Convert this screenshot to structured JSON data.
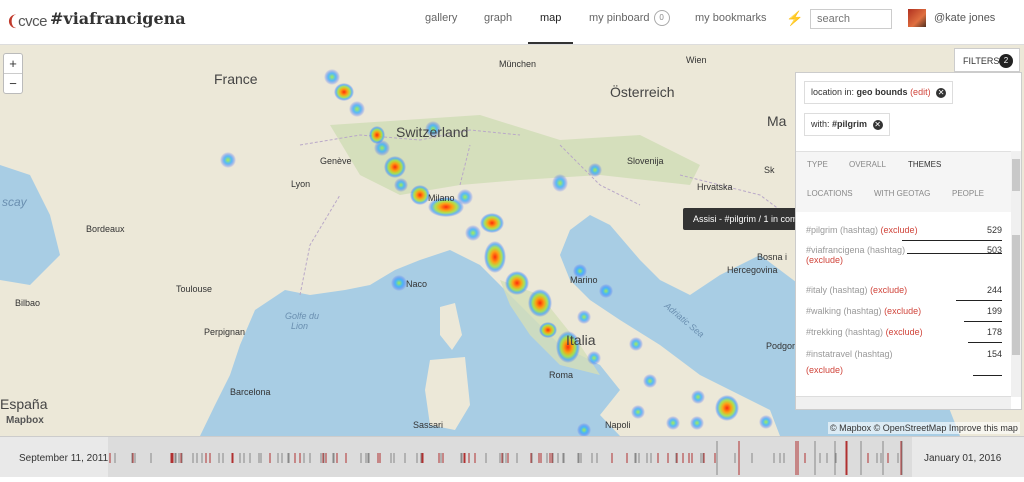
{
  "app": {
    "logo": "cvce",
    "title": "#viafrancigena"
  },
  "nav": {
    "items": [
      {
        "label": "gallery",
        "active": false
      },
      {
        "label": "graph",
        "active": false
      },
      {
        "label": "map",
        "active": true
      },
      {
        "label": "my pinboard",
        "active": false
      },
      {
        "label": "my bookmarks",
        "active": false
      }
    ],
    "pinboard_count": "0",
    "search_placeholder": "search",
    "user": "@kate jones"
  },
  "map": {
    "zoom_in": "+",
    "zoom_out": "−",
    "labels": {
      "france": "France",
      "switzerland": "Switzerland",
      "munchen": "München",
      "wien": "Wien",
      "osterreich": "Österreich",
      "slovenija": "Slovenija",
      "hrvatska": "Hrvatska",
      "geneve": "Genève",
      "lyon": "Lyon",
      "milano": "Milano",
      "bordeaux": "Bordeaux",
      "toulouse": "Toulouse",
      "bilbao": "Bilbao",
      "perpignan": "Perpignan",
      "barcelona": "Barcelona",
      "espana": "España",
      "italia": "Italia",
      "roma": "Roma",
      "napoli": "Napoli",
      "sassari": "Sassari",
      "podgorica": "Podgorica",
      "bosna": "Bosna i",
      "hercegovina": "Hercegovina",
      "marino": "Marino",
      "naco": "Naco",
      "golfe": "Golfe du",
      "lion": "Lion",
      "adriatic": "Adriatic Sea",
      "scay": "scay",
      "ma": "Ma",
      "sk": "Sk"
    },
    "tooltip": "Assisi - #pilgrim / 1 in common",
    "attribution": "© Mapbox © OpenStreetMap Improve this map",
    "mapbox_logo": "Mapbox"
  },
  "filters": {
    "tab_label": "FILTERS",
    "count": "2",
    "chips": [
      {
        "prefix": "location in:",
        "value": "geo bounds",
        "edit": "(edit)"
      },
      {
        "prefix": "with:",
        "value": "#pilgrim"
      }
    ],
    "tabs": [
      "TYPE",
      "OVERALL",
      "THEMES",
      "LOCATIONS",
      "WITH GEOTAG",
      "PEOPLE"
    ],
    "active_tab": "THEMES",
    "rows": [
      {
        "tag": "#pilgrim (hashtag)",
        "exclude": "(exclude)",
        "count": "529",
        "fraction": 1.0
      },
      {
        "tag": "#viafrancigena (hashtag)",
        "exclude": "(exclude)",
        "count": "503",
        "fraction": 0.95
      },
      {
        "tag": "#italy (hashtag)",
        "exclude": "(exclude)",
        "count": "244",
        "fraction": 0.46
      },
      {
        "tag": "#walking (hashtag)",
        "exclude": "(exclude)",
        "count": "199",
        "fraction": 0.38
      },
      {
        "tag": "#trekking (hashtag)",
        "exclude": "(exclude)",
        "count": "178",
        "fraction": 0.34
      },
      {
        "tag": "#instatravel (hashtag)",
        "exclude": "(exclude)",
        "count": "154",
        "fraction": 0.29
      }
    ]
  },
  "timeline": {
    "start": "September 11, 2011",
    "end": "January 01, 2016"
  }
}
